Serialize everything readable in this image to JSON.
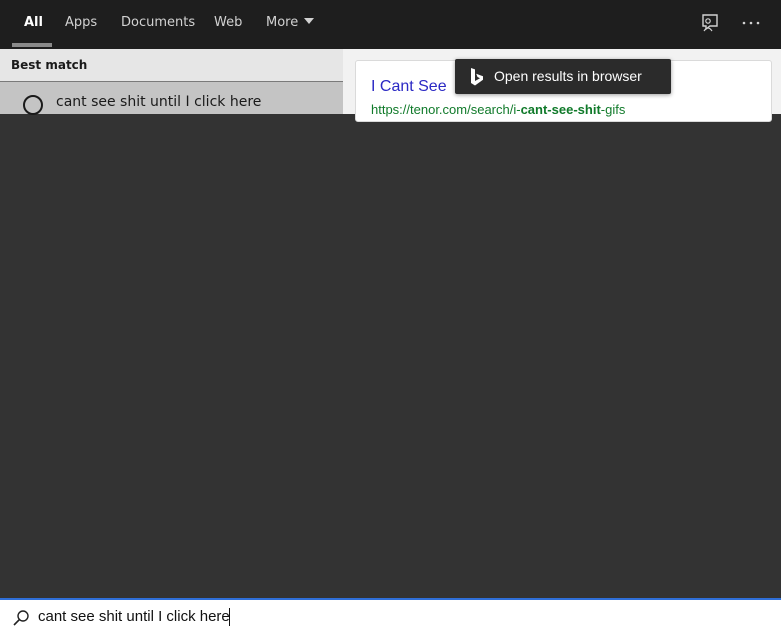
{
  "tabs": [
    {
      "label": "All",
      "active": true
    },
    {
      "label": "Apps"
    },
    {
      "label": "Documents"
    },
    {
      "label": "Web"
    },
    {
      "label": "More"
    }
  ],
  "top_icons": [
    "feedback-icon",
    "more-options-icon"
  ],
  "best_match": {
    "label": "Best match",
    "result_text": "cant see shit until I click here",
    "icon": "search-icon"
  },
  "web_result": {
    "title": "I Cant See",
    "url_prefix": "https://tenor.com/search/i-",
    "url_bold": "cant-see-shit",
    "url_suffix": "-gifs"
  },
  "tooltip": {
    "text": "Open results in browser",
    "icon": "bing-icon"
  },
  "search": {
    "value": "cant see shit until I click here",
    "icon": "search-icon"
  },
  "colors": {
    "accent": "#2f6fd8",
    "link": "#2b29c4",
    "url": "#107a2a",
    "background": "#333333",
    "topbar": "#1e1e1e"
  }
}
